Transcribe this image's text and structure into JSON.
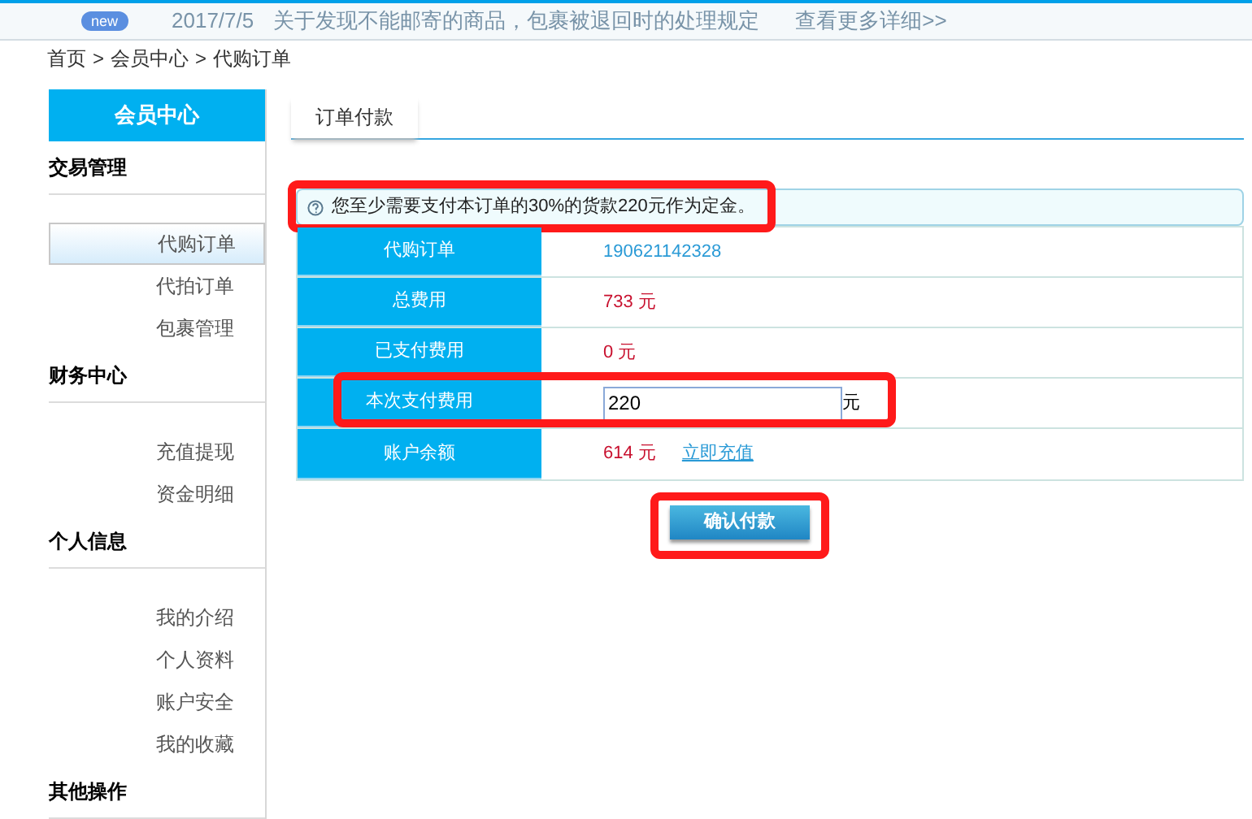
{
  "announcement": {
    "badge": "new",
    "date": "2017/7/5",
    "text": "关于发现不能邮寄的商品，包裹被退回时的处理规定",
    "link": "查看更多详细>>"
  },
  "breadcrumb": [
    "首页",
    ">",
    "会员中心",
    ">",
    "代购订单"
  ],
  "sidebar": {
    "title": "会员中心",
    "groups": [
      {
        "label": "交易管理",
        "items": [
          {
            "label": "代购订单",
            "selected": true
          },
          {
            "label": "代拍订单",
            "selected": false
          },
          {
            "label": "包裹管理",
            "selected": false
          }
        ]
      },
      {
        "label": "财务中心",
        "items": [
          {
            "label": "充值提现",
            "selected": false
          },
          {
            "label": "资金明细",
            "selected": false
          }
        ]
      },
      {
        "label": "个人信息",
        "items": [
          {
            "label": "我的介绍",
            "selected": false
          },
          {
            "label": "个人资料",
            "selected": false
          },
          {
            "label": "账户安全",
            "selected": false
          },
          {
            "label": "我的收藏",
            "selected": false
          }
        ]
      },
      {
        "label": "其他操作"
      }
    ]
  },
  "tabs": [
    {
      "label": "订单付款",
      "selected": true
    }
  ],
  "notice": {
    "text": "您至少需要支付本订单的30%的货款220元作为定金。",
    "highlighted": true
  },
  "rows": [
    {
      "kind": "link",
      "label": "代购订单",
      "value": "190621142328",
      "highlighted": false
    },
    {
      "kind": "amount",
      "label": "总费用",
      "value": "733 元",
      "highlighted": false
    },
    {
      "kind": "amount",
      "label": "已支付费用",
      "value": "0 元",
      "highlighted": false
    },
    {
      "kind": "input",
      "label": "本次支付费用",
      "value": "220",
      "unit": "元",
      "highlighted": true
    },
    {
      "kind": "amount",
      "label": "账户余额",
      "value": "614 元",
      "action": "立即充值",
      "highlighted": false
    }
  ],
  "confirm_button": {
    "label": "确认付款",
    "highlighted": true
  }
}
